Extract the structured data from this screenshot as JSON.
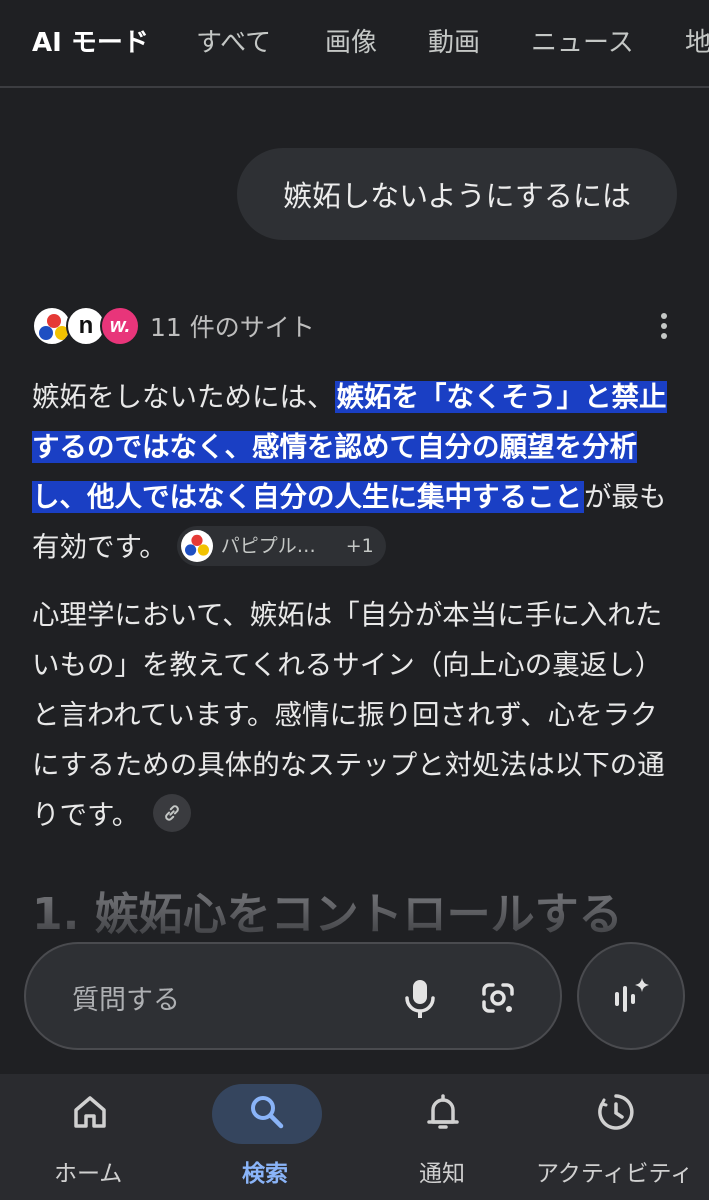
{
  "tabs": [
    {
      "label": "AI モード",
      "active": true
    },
    {
      "label": "すべて"
    },
    {
      "label": "画像"
    },
    {
      "label": "動画"
    },
    {
      "label": "ニュース"
    },
    {
      "label": "地"
    }
  ],
  "query": "嫉妬しないようにするには",
  "sources": {
    "count_label": "11 件のサイト",
    "icons": [
      "papipuru-icon",
      "n-site-icon",
      "w-site-icon"
    ]
  },
  "answer": {
    "p1_pre": "嫉妬をしないためには、",
    "p1_highlight": "嫉妬を「なくそう」と禁止するのではなく、感情を認めて自分の願望を分析し、他人ではなく自分の人生に集中すること",
    "p1_post": "が最も有効です。",
    "citation": {
      "label": "パピプル…",
      "more": "+1"
    },
    "p2": "心理学において、嫉妬は「自分が本当に手に入れたいもの」を教えてくれるサイン（向上心の裏返し）と言われています。感情に振り回されず、心をラクにするための具体的なステップと対処法は以下の通りです。",
    "heading": "1. 嫉妬心をコントロールする"
  },
  "input": {
    "placeholder": "質問する"
  },
  "nav": [
    {
      "label": "ホーム",
      "icon": "home-icon"
    },
    {
      "label": "検索",
      "icon": "search-icon",
      "active": true
    },
    {
      "label": "通知",
      "icon": "bell-icon"
    },
    {
      "label": "アクティビティ",
      "icon": "activity-icon"
    }
  ],
  "colors": {
    "background": "#1f2023",
    "highlight": "#1a3fc4",
    "active_nav": "#8ab4f8",
    "active_pill": "#35455e"
  }
}
